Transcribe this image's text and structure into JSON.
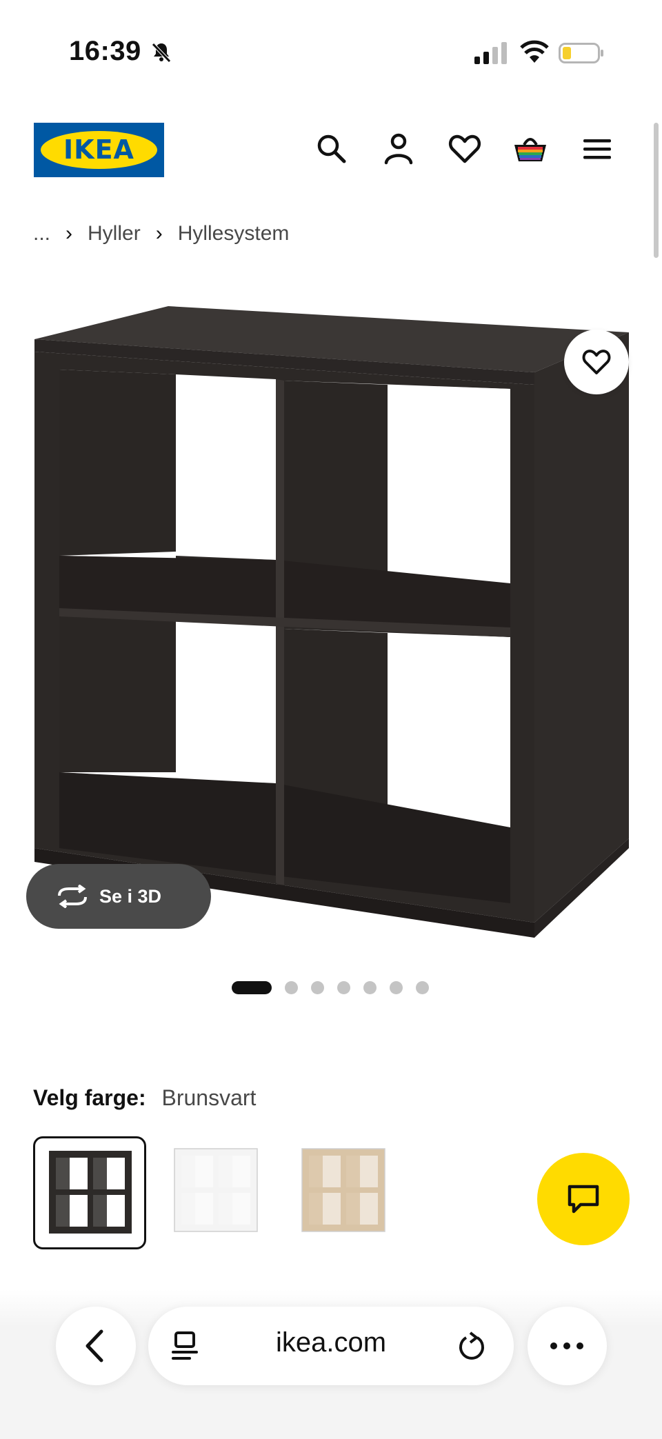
{
  "status_bar": {
    "time": "16:39"
  },
  "header": {
    "logo_text": "IKEA",
    "icons": [
      "search-icon",
      "user-icon",
      "heart-icon",
      "shopping-bag-icon",
      "menu-icon"
    ]
  },
  "breadcrumb": {
    "ellipsis": "...",
    "items": [
      "Hyller",
      "Hyllesystem"
    ]
  },
  "product": {
    "view_3d_label": "Se i 3D",
    "gallery_count": 7,
    "gallery_active": 1
  },
  "color": {
    "label": "Velg farge:",
    "value": "Brunsvart",
    "swatches": [
      "brunsvart",
      "hvit",
      "eikeeffekt"
    ],
    "swatch_colors": [
      "#2d2a28",
      "#f4f4f4",
      "#d9c4a6"
    ],
    "selected_index": 0
  },
  "browser": {
    "url": "ikea.com"
  },
  "colors": {
    "ikea_blue": "#0058A3",
    "ikea_yellow": "#FFDB00"
  }
}
